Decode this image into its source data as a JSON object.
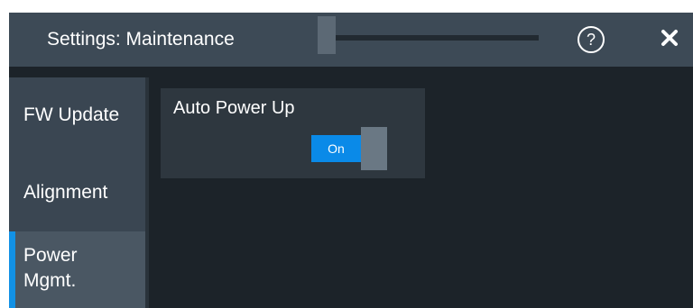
{
  "dialog": {
    "title": "Settings: Maintenance",
    "help_label": "?",
    "close_icon": "close-icon"
  },
  "sidebar": {
    "items": [
      {
        "label": "FW Update",
        "active": false
      },
      {
        "label": "Alignment",
        "active": false
      },
      {
        "label": "Power Mgmt.",
        "active": true
      }
    ]
  },
  "main": {
    "auto_power_up": {
      "label": "Auto Power Up",
      "state": "On"
    }
  },
  "colors": {
    "accent": "#1291e5",
    "toggle_on": "#0a8ae8",
    "background": "#1c2329",
    "titlebar": "#3d4a56"
  }
}
